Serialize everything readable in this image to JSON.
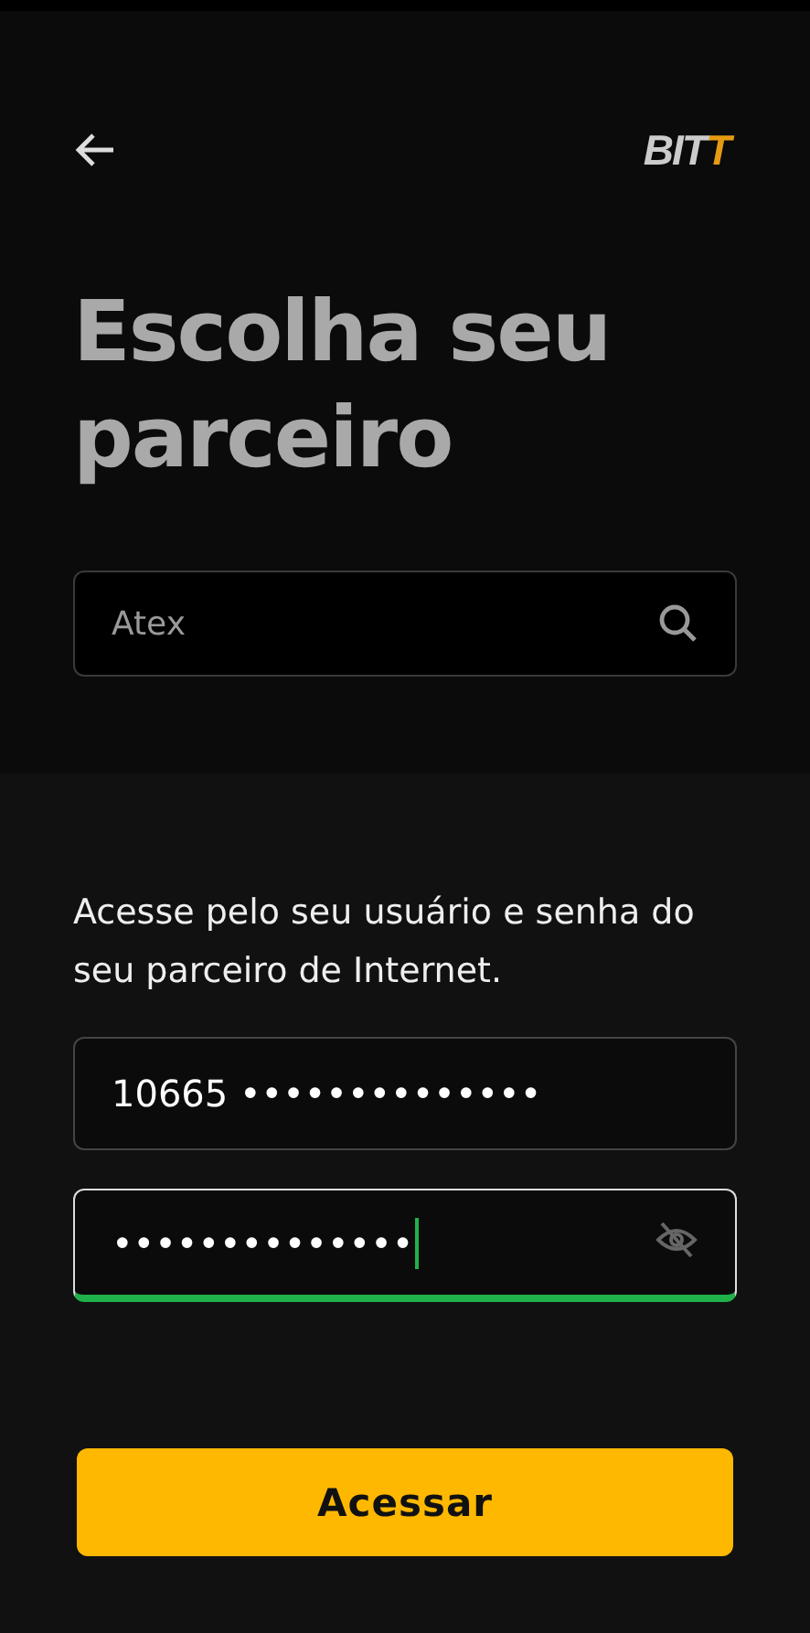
{
  "header": {
    "logo": {
      "main": "BIT",
      "accent": "T"
    }
  },
  "title": "Escolha seu parceiro",
  "search": {
    "value": "Atex"
  },
  "login": {
    "instructions": "Acesse pelo seu usuário e senha do seu parceiro de Internet.",
    "username": {
      "value": "10665 ••••••••••••••",
      "focused": false
    },
    "password": {
      "value": "••••••••••••••",
      "focused": true,
      "visible": false
    }
  },
  "button": "Acessar"
}
